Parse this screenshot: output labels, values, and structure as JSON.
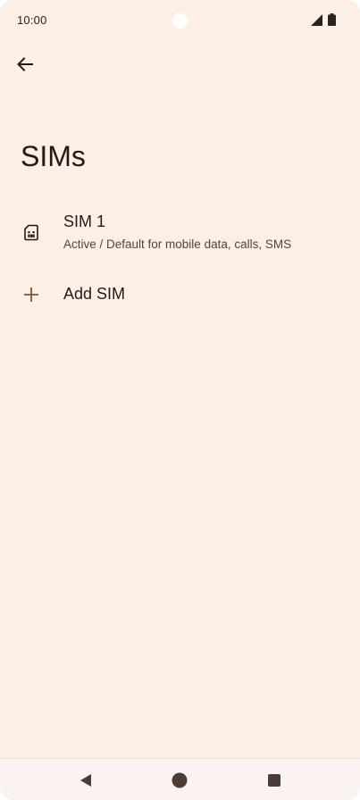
{
  "status_bar": {
    "time": "10:00",
    "icons": [
      "signal-icon",
      "battery-icon"
    ]
  },
  "header": {
    "back_icon": "arrow-back-icon",
    "title": "SIMs"
  },
  "list": {
    "items": [
      {
        "icon": "sim-card-icon",
        "title": "SIM 1",
        "subtitle": "Active / Default for mobile data, calls, SMS"
      },
      {
        "icon": "plus-icon",
        "title": "Add SIM"
      }
    ]
  },
  "nav_bar": {
    "buttons": [
      "nav-back-icon",
      "nav-home-icon",
      "nav-recents-icon"
    ]
  },
  "colors": {
    "background": "#fcefe6",
    "text_primary": "#231a16",
    "text_secondary": "#53433c",
    "accent": "#8a5032",
    "nav_bar": "#fbf3f2"
  }
}
